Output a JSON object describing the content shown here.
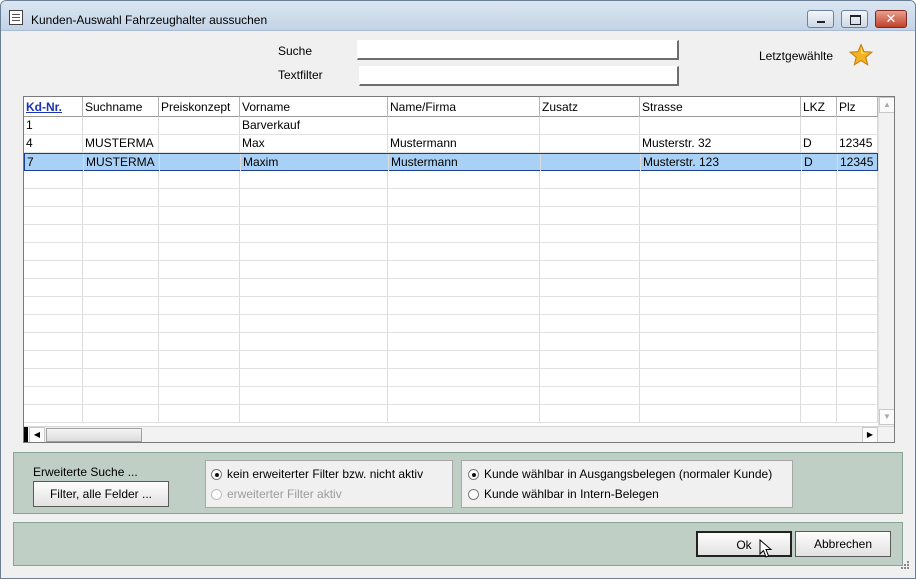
{
  "window": {
    "title": "Kunden-Auswahl Fahrzeughalter aussuchen"
  },
  "search": {
    "suche_label": "Suche",
    "suche_value": "",
    "textfilter_label": "Textfilter",
    "textfilter_value": "",
    "recent_label": "Letztgewählte"
  },
  "grid": {
    "columns": [
      {
        "label": "Kd-Nr."
      },
      {
        "label": "Suchname"
      },
      {
        "label": "Preiskonzept"
      },
      {
        "label": "Vorname"
      },
      {
        "label": "Name/Firma"
      },
      {
        "label": "Zusatz"
      },
      {
        "label": "Strasse"
      },
      {
        "label": "LKZ"
      },
      {
        "label": "Plz"
      }
    ],
    "rows": [
      [
        "1",
        "",
        "",
        "Barverkauf",
        "",
        "",
        "",
        "",
        ""
      ],
      [
        "4",
        "MUSTERMA",
        "",
        "Max",
        "Mustermann",
        "",
        "Musterstr. 32",
        "D",
        "12345"
      ],
      [
        "7",
        "MUSTERMA",
        "",
        "Maxim",
        "Mustermann",
        "",
        "Musterstr. 123",
        "D",
        "12345"
      ]
    ],
    "selected_row": 2
  },
  "filter": {
    "extended_label": "Erweiterte Suche ...",
    "all_fields_button": "Filter, alle Felder ...",
    "opt_none": "kein erweiterter Filter bzw. nicht aktiv",
    "opt_active": "erweiterter Filter aktiv",
    "opt_outgoing": "Kunde wählbar in Ausgangsbelegen (normaler Kunde)",
    "opt_internal": "Kunde wählbar in Intern-Belegen"
  },
  "actions": {
    "ok": "Ok",
    "cancel": "Abbrechen"
  },
  "colors": {
    "selection": "#a9d1f6",
    "panel": "#c0cfc6",
    "sort_header": "#1a32b5"
  },
  "icons": [
    "app-icon",
    "star-icon",
    "scroll-up-icon",
    "scroll-down-icon",
    "scroll-left-icon",
    "scroll-right-icon",
    "resize-grip-icon",
    "mouse-cursor-icon"
  ]
}
